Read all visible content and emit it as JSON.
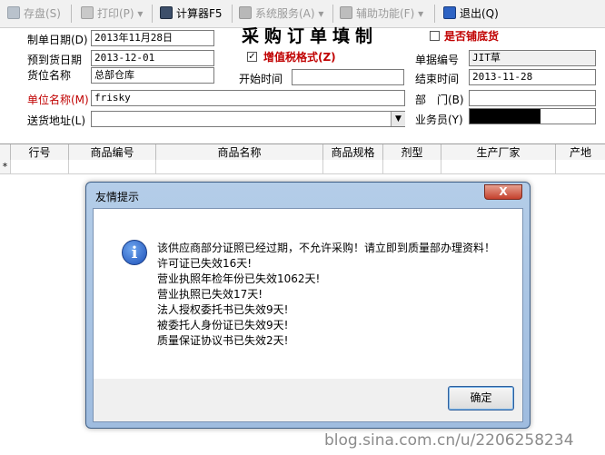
{
  "toolbar": {
    "save_label": "存盘(S)",
    "print_label": "打印(P)",
    "calculator_label": "计算器F5",
    "system_service_label": "系统服务(A)",
    "aux_function_label": "辅助功能(F)",
    "exit_label": "退出(Q)"
  },
  "form": {
    "title": "采购订单填制",
    "order_date_label": "制单日期(D)",
    "order_date_value": "2013年11月28日",
    "expected_arrival_label": "预到货日期",
    "expected_arrival_value": "2013-12-01",
    "warehouse_label": "货位名称",
    "warehouse_value": "总部仓库",
    "vat_label": "增值税格式(Z)",
    "start_time_label": "开始时间",
    "start_time_value": "",
    "bottom_stock_label": "是否铺底货",
    "doc_number_label": "单据编号",
    "doc_number_value": "JIT草",
    "end_time_label": "结束时间",
    "end_time_value": "2013-11-28",
    "unit_name_label": "单位名称(M)",
    "unit_name_value": "frisky",
    "department_label": "部　门(B)",
    "department_value": "",
    "delivery_address_label": "送货地址(L)",
    "delivery_address_value": "",
    "salesman_label": "业务员(Y)",
    "salesman_value": ""
  },
  "grid": {
    "columns": [
      "行号",
      "商品编号",
      "商品名称",
      "商品规格",
      "剂型",
      "生产厂家",
      "产地"
    ],
    "row_marker": "*"
  },
  "dialog": {
    "title": "友情提示",
    "close_label": "X",
    "messages": [
      "该供应商部分证照已经过期，不允许采购！请立即到质量部办理资料！",
      "许可证已失效16天!",
      "营业执照年检年份已失效1062天!",
      "营业执照已失效17天!",
      "法人授权委托书已失效9天!",
      "被委托人身份证已失效9天!",
      "质量保证协议书已失效2天!"
    ],
    "ok_label": "确定"
  },
  "watermark": "blog.sina.com.cn/u/2206258234",
  "colors": {
    "accent_red": "#c00000",
    "dialog_frame": "#b4cde8",
    "close_red": "#c4402c"
  }
}
